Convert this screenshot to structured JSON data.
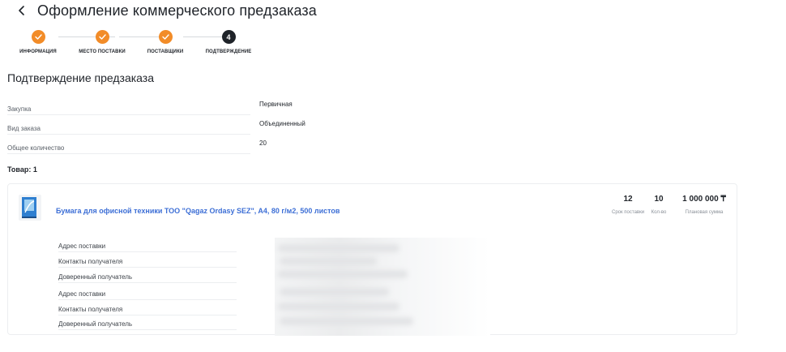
{
  "header": {
    "title": "Оформление коммерческого предзаказа",
    "back_icon": "chevron-left-icon"
  },
  "stepper": {
    "steps": [
      {
        "label": "ИНФОРМАЦИЯ",
        "state": "done"
      },
      {
        "label": "МЕСТО ПОСТАВКИ",
        "state": "done"
      },
      {
        "label": "ПОСТАВЩИКИ",
        "state": "done"
      },
      {
        "label": "ПОДТВЕРЖДЕНИЕ",
        "state": "current",
        "number": "4"
      }
    ],
    "colors": {
      "done": "#f28c28",
      "current": "#1f2329"
    }
  },
  "section": {
    "title": "Подтверждение предзаказа"
  },
  "info": [
    {
      "label": "Закупка",
      "value": "Первичная"
    },
    {
      "label": "Вид заказа",
      "value": "Объединенный"
    },
    {
      "label": "Общее количество",
      "value": "20"
    }
  ],
  "goods": {
    "count_label": "Товар: 1",
    "item": {
      "name": "Бумага для офисной техники ТОО \"Qagaz Ordasy SEZ\", A4, 80 г/м2, 500 листов",
      "link_color": "#3d6fd6",
      "metrics": [
        {
          "value": "12",
          "label": "Срок поставки"
        },
        {
          "value": "10",
          "label": "Кол-во"
        },
        {
          "value": "1 000 000 ₸",
          "label": "Плановая сумма"
        }
      ],
      "details": [
        "Адрес поставки",
        "Контакты получателя",
        "Доверенный получатель",
        "Адрес поставки",
        "Контакты получателя",
        "Доверенный получатель"
      ]
    }
  }
}
